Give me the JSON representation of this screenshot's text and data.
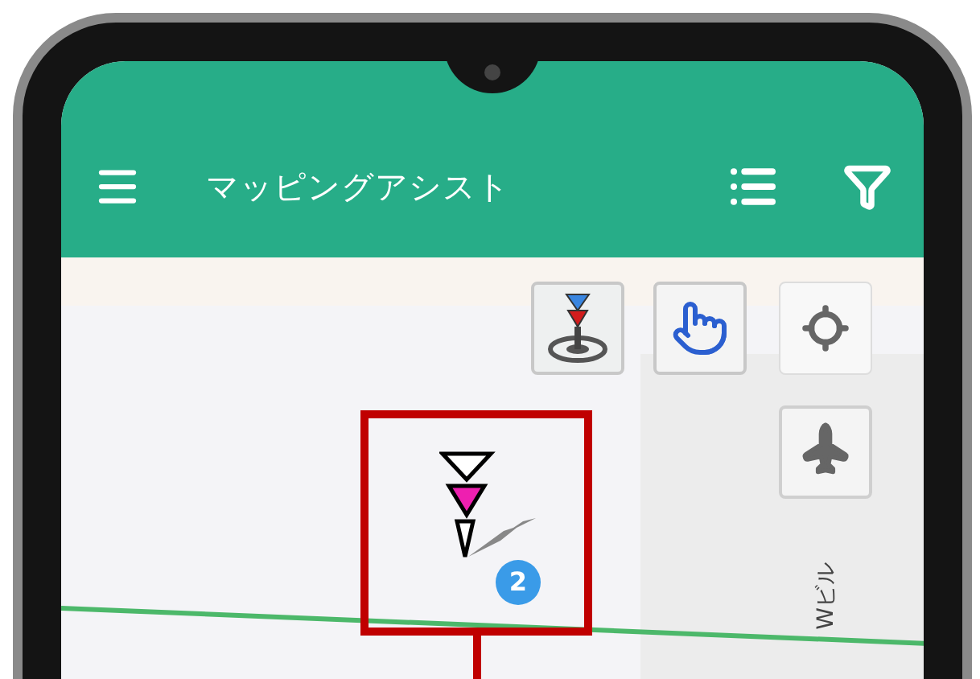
{
  "app_bar": {
    "title": "マッピングアシスト"
  },
  "map": {
    "place_label": "Wビル",
    "marker": {
      "badge": "2"
    }
  }
}
